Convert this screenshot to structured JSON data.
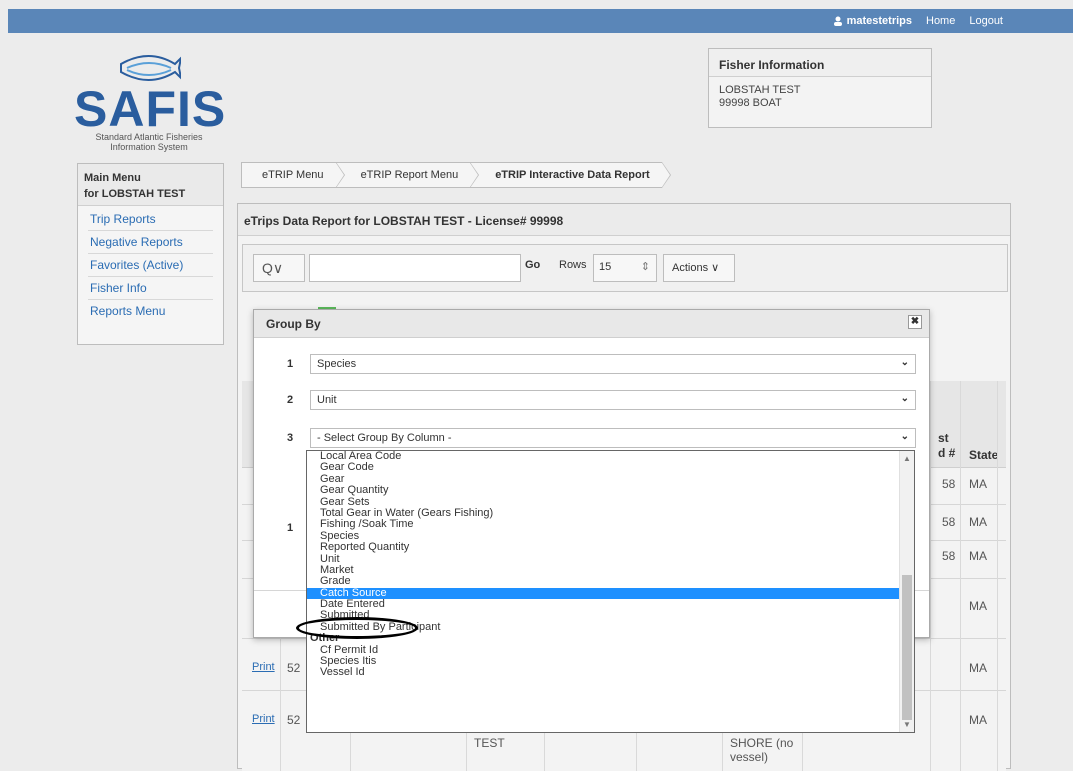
{
  "topbar": {
    "user": "matestetrips",
    "home": "Home",
    "logout": "Logout"
  },
  "logo": {
    "title": "SAFIS",
    "sub1": "Standard Atlantic Fisheries",
    "sub2": "Information System"
  },
  "fisher": {
    "header": "Fisher Information",
    "line1": "LOBSTAH TEST",
    "line2": "99998 BOAT"
  },
  "main_menu": {
    "title": "Main Menu",
    "subtitle": "for LOBSTAH TEST",
    "items": [
      "Trip Reports",
      "Negative Reports",
      "Favorites (Active)",
      "Fisher Info",
      "Reports Menu"
    ]
  },
  "breadcrumb": [
    "eTRIP Menu",
    "eTRIP Report Menu",
    "eTRIP Interactive Data Report"
  ],
  "report": {
    "title": "eTrips Data Report for LOBSTAH TEST - License# 99998"
  },
  "toolbar": {
    "search_icon": "Q∨",
    "go": "Go",
    "rows_label": "Rows",
    "rows_value": "15",
    "actions": "Actions ∨"
  },
  "table": {
    "col_state": "State",
    "col_partial1": "st",
    "col_partial2": "d #",
    "rows": [
      {
        "num": "58",
        "state": "MA"
      },
      {
        "num": "58",
        "state": "MA"
      },
      {
        "num": "58",
        "state": "MA"
      },
      {
        "num": "",
        "state": "MA"
      },
      {
        "print": "Print",
        "id": "52",
        "state": "MA"
      },
      {
        "print": "Print",
        "id": "52",
        "test": "TEST",
        "shore1": "SHORE (no",
        "shore2": "vessel)",
        "state": "MA"
      }
    ],
    "row_one": "1"
  },
  "group_by": {
    "title": "Group By",
    "close": "✖",
    "rows": [
      {
        "num": "1",
        "value": "Species"
      },
      {
        "num": "2",
        "value": "Unit"
      },
      {
        "num": "3",
        "value": "- Select Group By Column -"
      }
    ],
    "hidden_num": "1"
  },
  "dropdown": {
    "options": [
      {
        "label": "Local Area Code"
      },
      {
        "label": "Gear Code"
      },
      {
        "label": "Gear"
      },
      {
        "label": "Gear Quantity"
      },
      {
        "label": "Gear Sets"
      },
      {
        "label": "Total Gear in Water (Gears Fishing)"
      },
      {
        "label": "Fishing /Soak Time"
      },
      {
        "label": "Species"
      },
      {
        "label": "Reported Quantity"
      },
      {
        "label": "Unit"
      },
      {
        "label": "Market"
      },
      {
        "label": "Grade"
      },
      {
        "label": "Catch Source",
        "selected": true
      },
      {
        "label": "Date Entered"
      },
      {
        "label": "Submitted"
      },
      {
        "label": "Submitted By Participant"
      },
      {
        "label": "Other",
        "group": true
      },
      {
        "label": "Cf Permit Id"
      },
      {
        "label": "Species Itis"
      },
      {
        "label": "Vessel Id"
      }
    ]
  }
}
